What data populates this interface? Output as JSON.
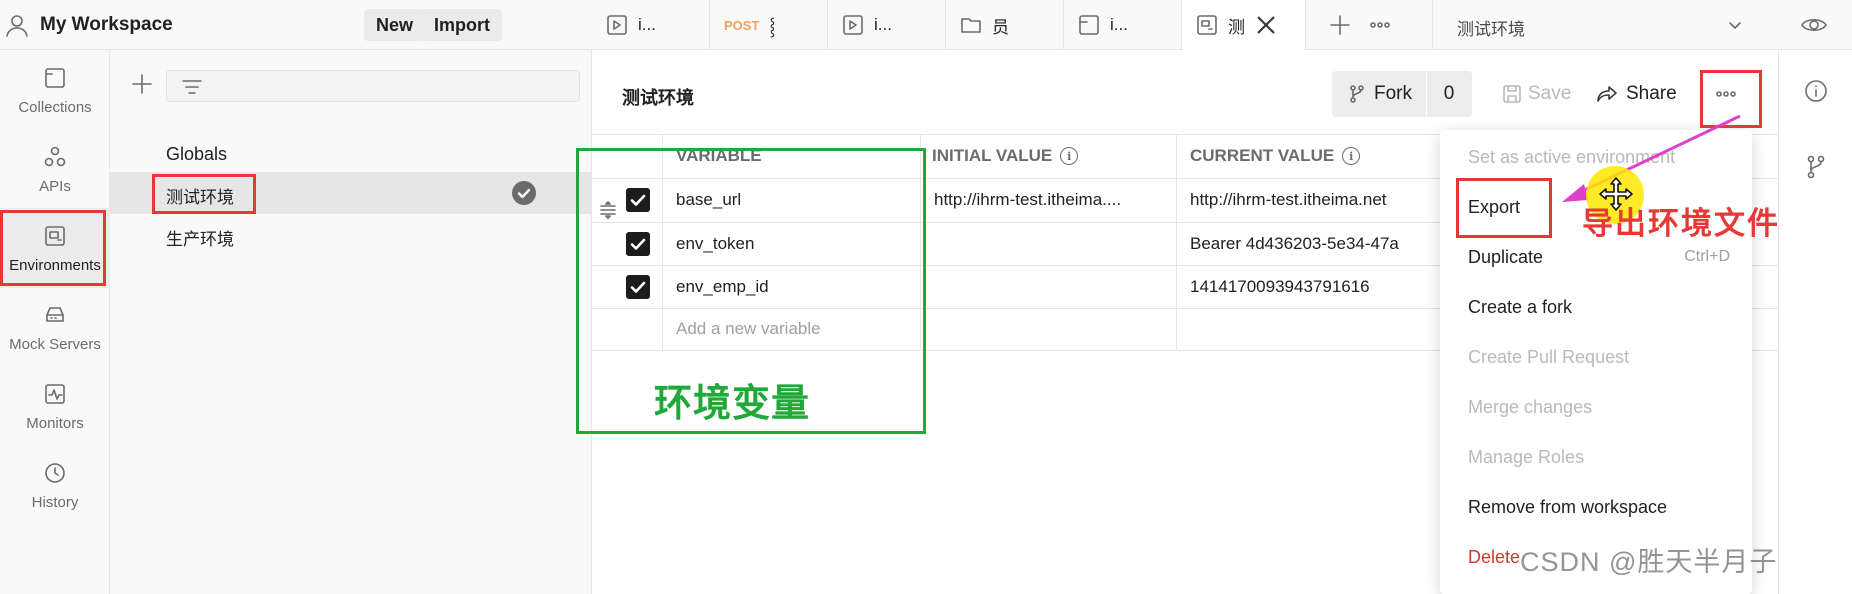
{
  "workspace": {
    "title": "My Workspace",
    "new_label": "New",
    "import_label": "Import"
  },
  "rail": {
    "items": [
      {
        "label": "Collections",
        "icon": "collections-icon"
      },
      {
        "label": "APIs",
        "icon": "apis-icon"
      },
      {
        "label": "Environments",
        "icon": "environments-icon"
      },
      {
        "label": "Mock Servers",
        "icon": "mock-servers-icon"
      },
      {
        "label": "Monitors",
        "icon": "monitors-icon"
      },
      {
        "label": "History",
        "icon": "history-icon"
      }
    ]
  },
  "env_panel": {
    "globals_label": "Globals",
    "environments": [
      {
        "name": "测试环境",
        "selected": true,
        "active": true
      },
      {
        "name": "生产环境",
        "selected": false,
        "active": false
      }
    ]
  },
  "tabs": [
    {
      "label": "i...",
      "icon": "request-icon",
      "method": ""
    },
    {
      "label": "⸾",
      "icon": "",
      "method": "POST"
    },
    {
      "label": "i...",
      "icon": "request-icon",
      "method": ""
    },
    {
      "label": "员",
      "icon": "folder-icon",
      "method": ""
    },
    {
      "label": "i...",
      "icon": "collection-icon",
      "method": ""
    },
    {
      "label": "测",
      "icon": "environment-icon",
      "method": "",
      "active": true
    }
  ],
  "env_selector": {
    "value": "测试环境"
  },
  "main": {
    "env_title": "测试环境",
    "fork_label": "Fork",
    "fork_count": "0",
    "save_label": "Save",
    "share_label": "Share"
  },
  "table": {
    "headers": [
      "VARIABLE",
      "INITIAL VALUE",
      "CURRENT VALUE"
    ],
    "rows": [
      {
        "variable": "base_url",
        "initial": "http://ihrm-test.itheima....",
        "current": "http://ihrm-test.itheima.net",
        "enabled": true
      },
      {
        "variable": "env_token",
        "initial": "",
        "current": "Bearer 4d436203-5e34-47a",
        "enabled": true
      },
      {
        "variable": "env_emp_id",
        "initial": "",
        "current": "1414170093943791616",
        "enabled": true
      }
    ],
    "add_placeholder": "Add a new variable"
  },
  "menu": {
    "items": [
      {
        "label": "Set as active environment",
        "disabled": true
      },
      {
        "label": "Export",
        "disabled": false
      },
      {
        "label": "Duplicate",
        "shortcut": "Ctrl+D",
        "disabled": false
      },
      {
        "label": "Create a fork",
        "disabled": false
      },
      {
        "label": "Create Pull Request",
        "disabled": true
      },
      {
        "label": "Merge changes",
        "disabled": true
      },
      {
        "label": "Manage Roles",
        "disabled": true
      },
      {
        "label": "Remove from workspace",
        "disabled": false
      },
      {
        "label": "Delete",
        "disabled": false,
        "danger": true
      }
    ]
  },
  "annotations": {
    "env_vars": "环境变量",
    "export_note": "导出环境文件"
  },
  "watermark": "CSDN @胜天半月子",
  "colors": {
    "annotation_red": "#e53935",
    "annotation_green": "#20a838",
    "post_method": "#f0a15c",
    "delete_text": "#d0392f"
  }
}
